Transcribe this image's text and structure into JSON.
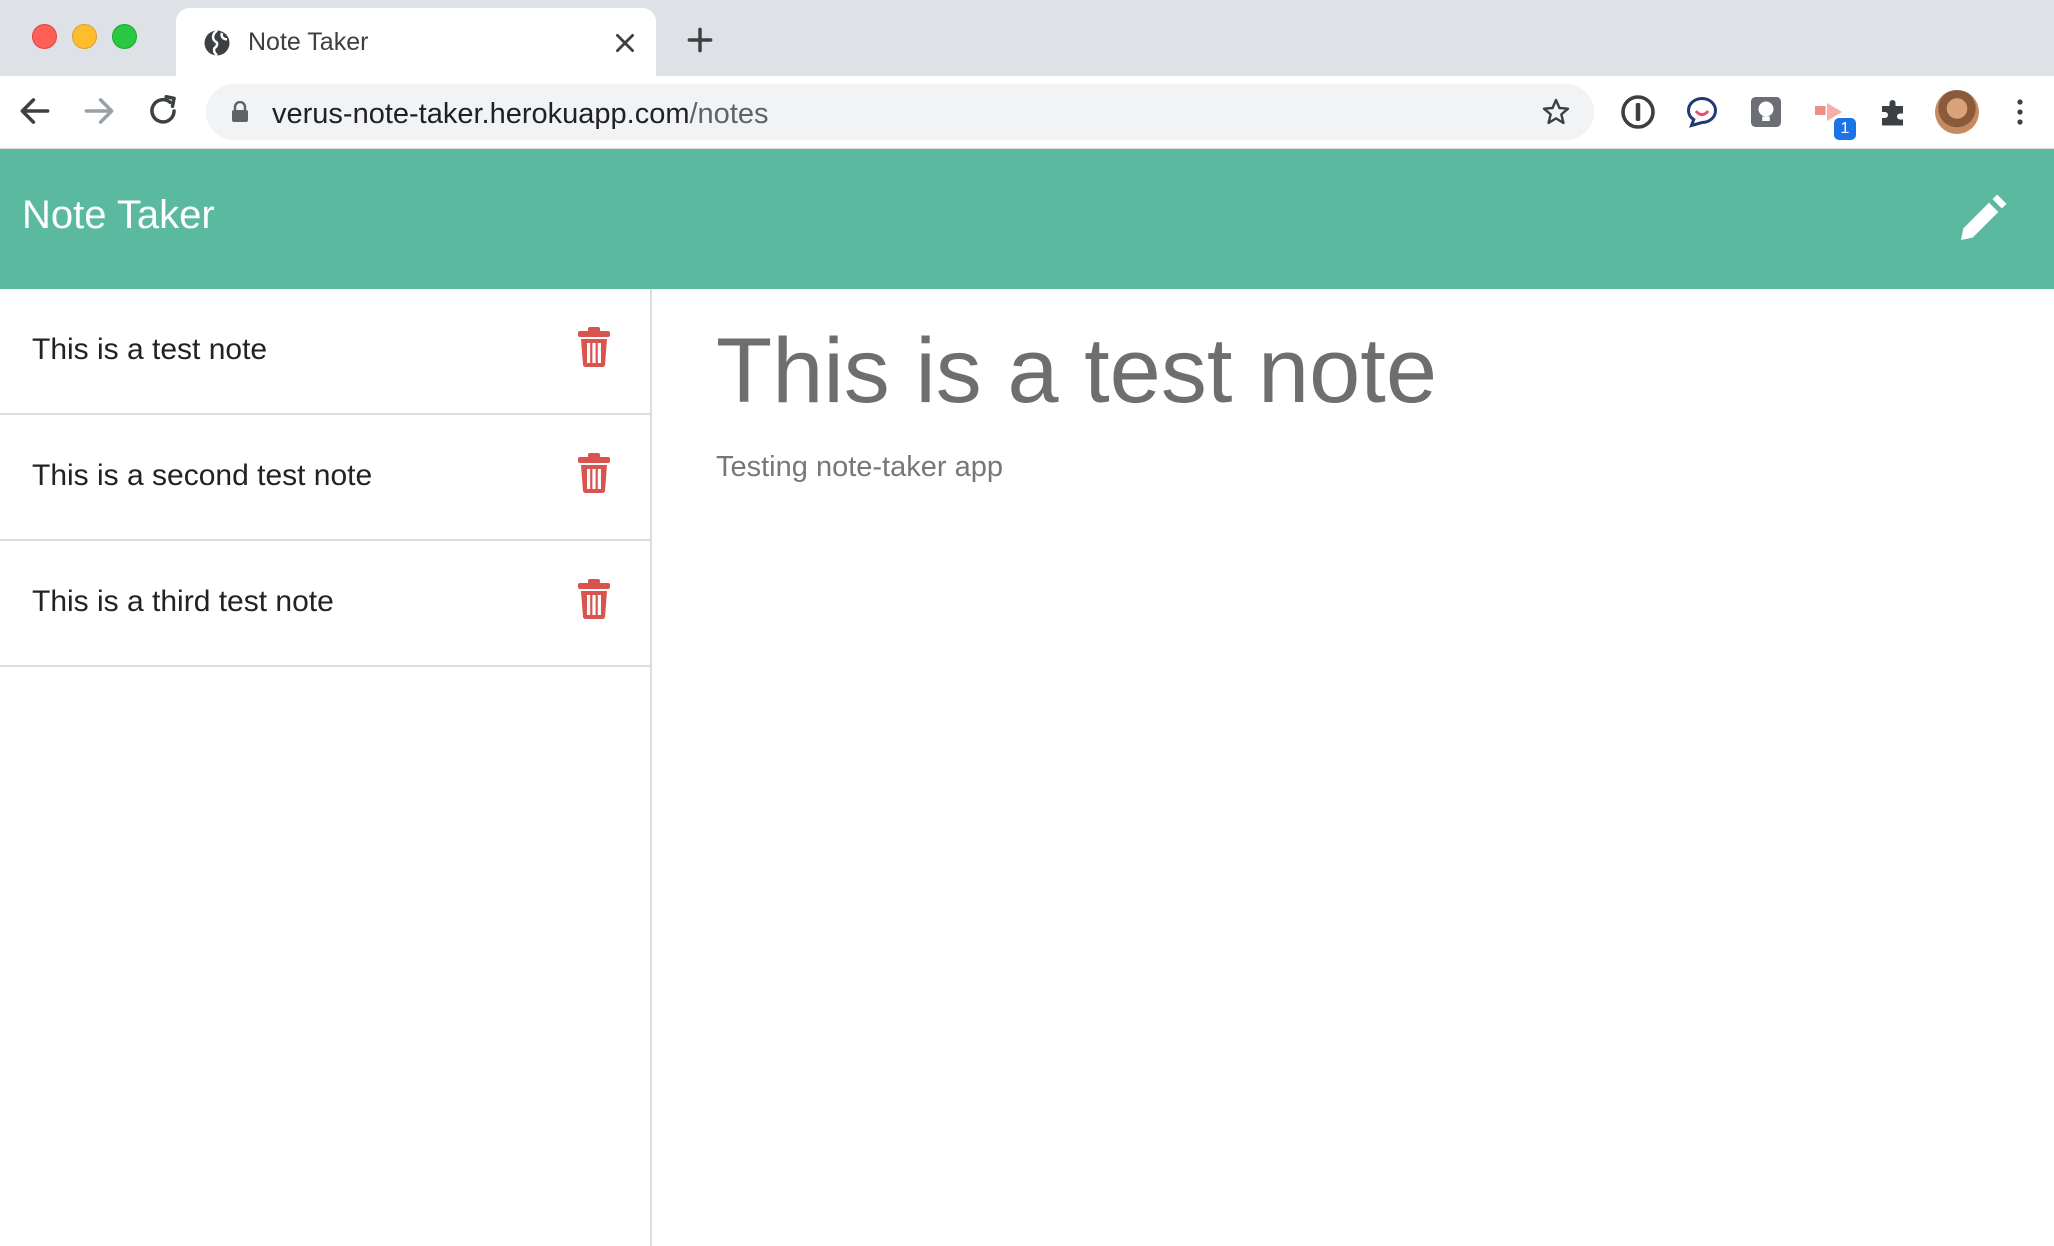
{
  "browser": {
    "tab_title": "Note Taker",
    "url_domain": "verus-note-taker.herokuapp.com",
    "url_path": "/notes",
    "extension_badge": "1"
  },
  "app": {
    "title": "Note Taker",
    "header_color": "#5ab99e",
    "delete_color": "#d9534f"
  },
  "sidebar": {
    "notes": [
      {
        "title": "This is a test note"
      },
      {
        "title": "This is a second test note"
      },
      {
        "title": "This is a third test note"
      }
    ]
  },
  "main": {
    "note_title": "This is a test note",
    "note_text": "Testing note-taker app"
  }
}
